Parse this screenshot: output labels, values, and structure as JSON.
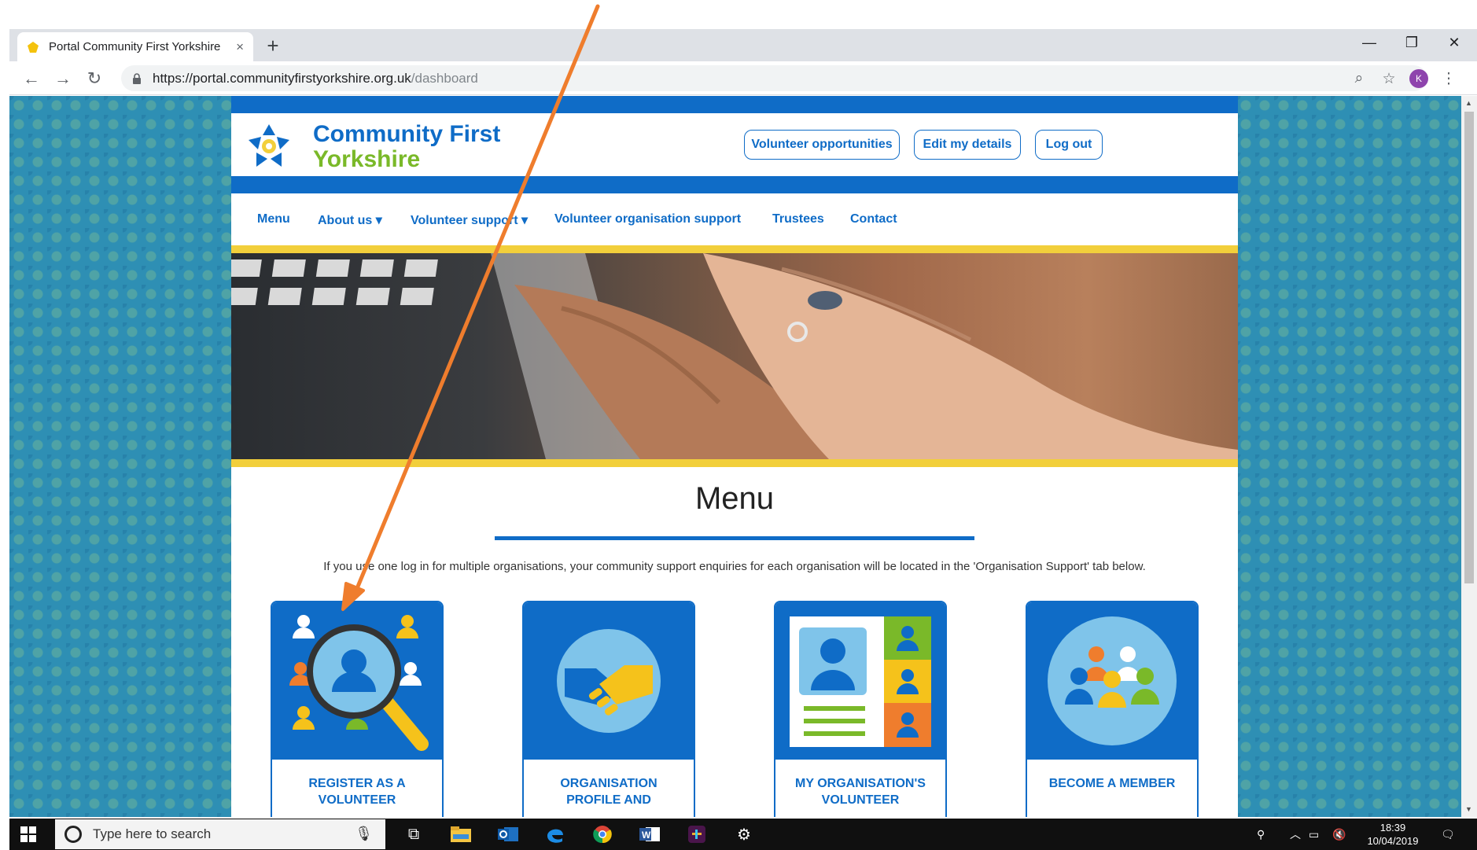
{
  "browser": {
    "tab_title": "Portal Community First Yorkshire",
    "tab_close": "×",
    "new_tab": "+",
    "url_host": "https://portal.communityfirstyorkshire.org.uk",
    "url_path": "/dashboard",
    "avatar_letter": "K",
    "window_min": "—",
    "window_restore": "❐",
    "window_close": "✕"
  },
  "site": {
    "brand_line1": "Community First",
    "brand_line2": "Yorkshire",
    "header_buttons": [
      "Volunteer opportunities",
      "Edit my details",
      "Log out"
    ],
    "nav": [
      "Menu",
      "About us ▾",
      "Volunteer support ▾",
      "Volunteer organisation support",
      "Trustees",
      "Contact"
    ],
    "menu_title": "Menu",
    "menu_note": "If you use one log in for multiple organisations, your community support enquiries for each organisation will be located in the 'Organisation Support' tab below.",
    "cards": [
      "REGISTER AS A VOLUNTEER",
      "ORGANISATION PROFILE AND",
      "MY ORGANISATION'S VOLUNTEER",
      "BECOME A MEMBER"
    ]
  },
  "taskbar": {
    "search_placeholder": "Type here to search",
    "time": "18:39",
    "date": "10/04/2019"
  },
  "colors": {
    "brand_blue": "#0f6cc7",
    "brand_green": "#7ab929",
    "accent_yellow": "#f2cf3b",
    "annotation_orange": "#ef7d2d"
  }
}
